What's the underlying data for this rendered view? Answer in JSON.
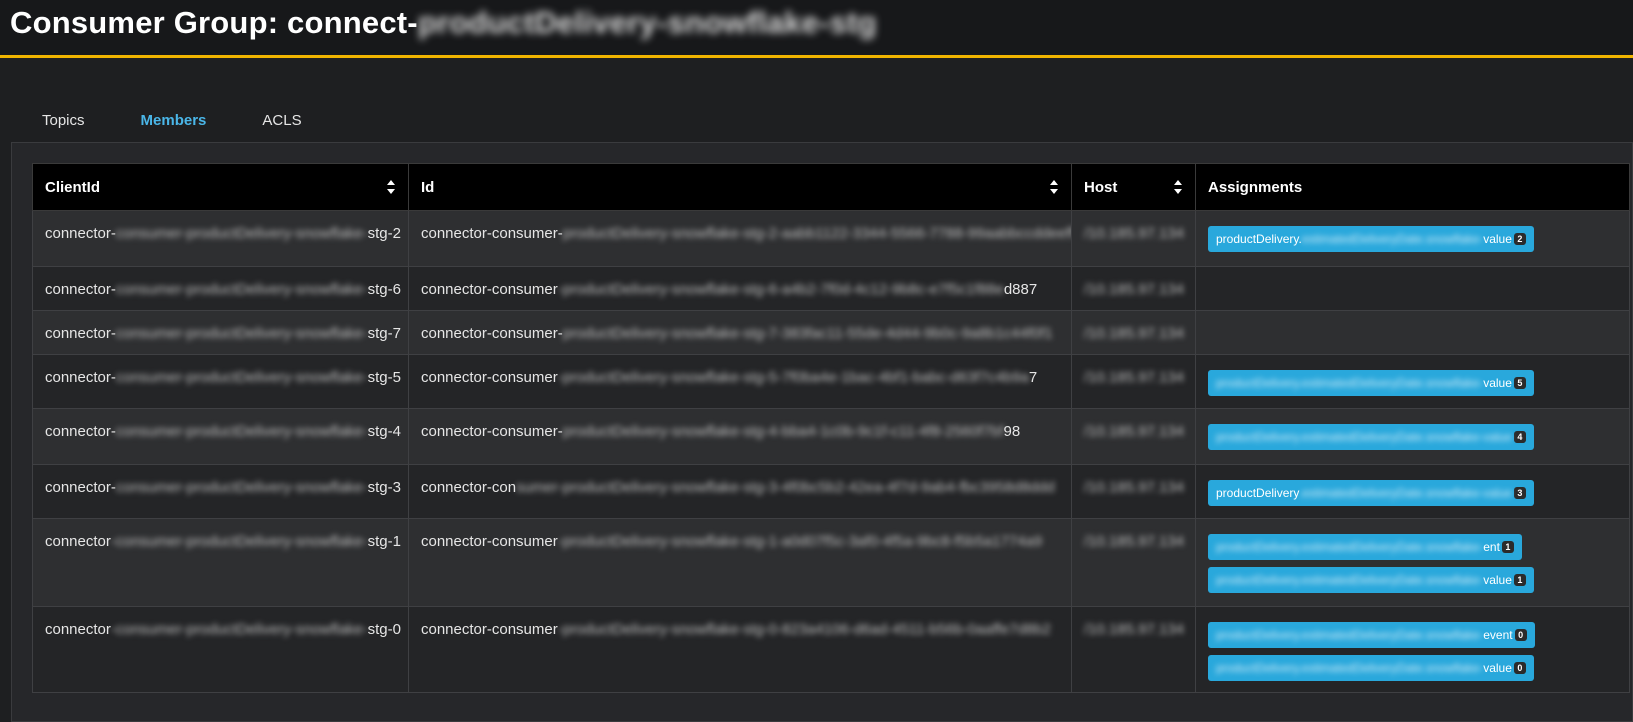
{
  "header": {
    "title_prefix": "Consumer Group: connect-",
    "title_obscured": "productDelivery-snowflake-stg"
  },
  "tabs": [
    {
      "label": "Topics",
      "active": false
    },
    {
      "label": "Members",
      "active": true
    },
    {
      "label": "ACLS",
      "active": false
    }
  ],
  "table": {
    "columns": [
      "ClientId",
      "Id",
      "Host",
      "Assignments"
    ],
    "rows": [
      {
        "client_prefix": "connector-",
        "client_obscured": "consumer-productDelivery-snowflake-",
        "client_suffix": "stg-2",
        "id_prefix": "connector-consumer-",
        "id_obscured": "productDelivery-snowflake-stg-2-aabb1122-3344-5566-7788-99aabbccddeeff77",
        "host": "/10.185.97.134",
        "assignments": [
          {
            "prefix": "productDelivery.",
            "obscured": "estimatedDeliveryDate.snowflake-",
            "suffix": "value",
            "count": "2"
          }
        ]
      },
      {
        "client_prefix": "connector-",
        "client_obscured": "consumer-productDelivery-snowflake-",
        "client_suffix": "stg-6",
        "id_prefix": "connector-consumer",
        "id_obscured": "-productDelivery-snowflake-stg-6-a4b2-7f0d-4c12-9b8c-e7f5c1f88e",
        "id_suffix": "d887",
        "host": "/10.185.97.134",
        "assignments": []
      },
      {
        "client_prefix": "connector-",
        "client_obscured": "consumer-productDelivery-snowflake-",
        "client_suffix": "stg-7",
        "id_prefix": "connector-consumer-",
        "id_obscured": "productDelivery-snowflake-stg-7-383fac11-55de-4d44-9b0c-9a8b1c44f0f1",
        "host": "/10.185.97.134",
        "assignments": []
      },
      {
        "client_prefix": "connector-",
        "client_obscured": "consumer-productDelivery-snowflake-",
        "client_suffix": "stg-5",
        "id_prefix": "connector-consumer",
        "id_obscured": "-productDelivery-snowflake-stg-5-7f0ba4e-1bac-4bf1-babc-d63f7c4b9a",
        "id_suffix": "7",
        "host": "/10.185.97.134",
        "assignments": [
          {
            "prefix": "",
            "obscured": "productDelivery.estimatedDeliveryDate.snowflake-",
            "suffix": "value",
            "count": "5"
          }
        ]
      },
      {
        "client_prefix": "connector-",
        "client_obscured": "consumer-productDelivery-snowflake-",
        "client_suffix": "stg-4",
        "id_prefix": "connector-consumer-",
        "id_obscured": "productDelivery-snowflake-stg-4-bba4-1c0b-9c1f-c11-4f8-2560f7bf",
        "id_suffix": "98",
        "host": "/10.185.97.134",
        "assignments": [
          {
            "prefix": "",
            "obscured": "productDelivery.estimatedDeliveryDate.snowflake-value",
            "suffix": "",
            "count": "4"
          }
        ]
      },
      {
        "client_prefix": "connector-",
        "client_obscured": "consumer-productDelivery-snowflake-",
        "client_suffix": "stg-3",
        "id_prefix": "connector-con",
        "id_obscured": "sumer-productDelivery-snowflake-stg-3-4f0bc5b2-42ea-4f7d-9ab4-fbc3958d8ddd",
        "host": "/10.185.97.134",
        "assignments": [
          {
            "prefix": "productDelivery",
            "obscured": ".estimatedDeliveryDate.snowflake-value",
            "suffix": "",
            "count": "3"
          }
        ]
      },
      {
        "client_prefix": "connector",
        "client_obscured": "-consumer-productDelivery-snowflake-",
        "client_suffix": "stg-1",
        "id_prefix": "connector-consumer",
        "id_obscured": "-productDelivery-snowflake-stg-1-a0d07f5c-3af0-4f5a-9bc8-f5b5a1774a9",
        "host": "/10.185.97.134",
        "assignments": [
          {
            "prefix": "",
            "obscured": "productDelivery.estimatedDeliveryDate.snowflake-",
            "suffix": "ent",
            "count": "1"
          },
          {
            "prefix": "",
            "obscured": "productDelivery.estimatedDeliveryDate.snowflake-",
            "suffix": "value",
            "count": "1"
          }
        ]
      },
      {
        "client_prefix": "connector",
        "client_obscured": "-consumer-productDelivery-snowflake-",
        "client_suffix": "stg-0",
        "id_prefix": "connector-consumer",
        "id_obscured": "-productDelivery-snowflake-stg-0-823a4106-d6ad-4511-b56b-0aaffe7d8b2",
        "host": "/10.185.97.134",
        "assignments": [
          {
            "prefix": "",
            "obscured": "productDelivery.estimatedDeliveryDate.snowflake-",
            "suffix": "event",
            "count": "0"
          },
          {
            "prefix": "",
            "obscured": "productDelivery.estimatedDeliveryDate.snowflake-",
            "suffix": "value",
            "count": "0"
          }
        ]
      }
    ]
  },
  "colors": {
    "accent_underline": "#f0b400",
    "active_tab": "#4ab6e8",
    "assignment_chip": "#29a8dc"
  }
}
